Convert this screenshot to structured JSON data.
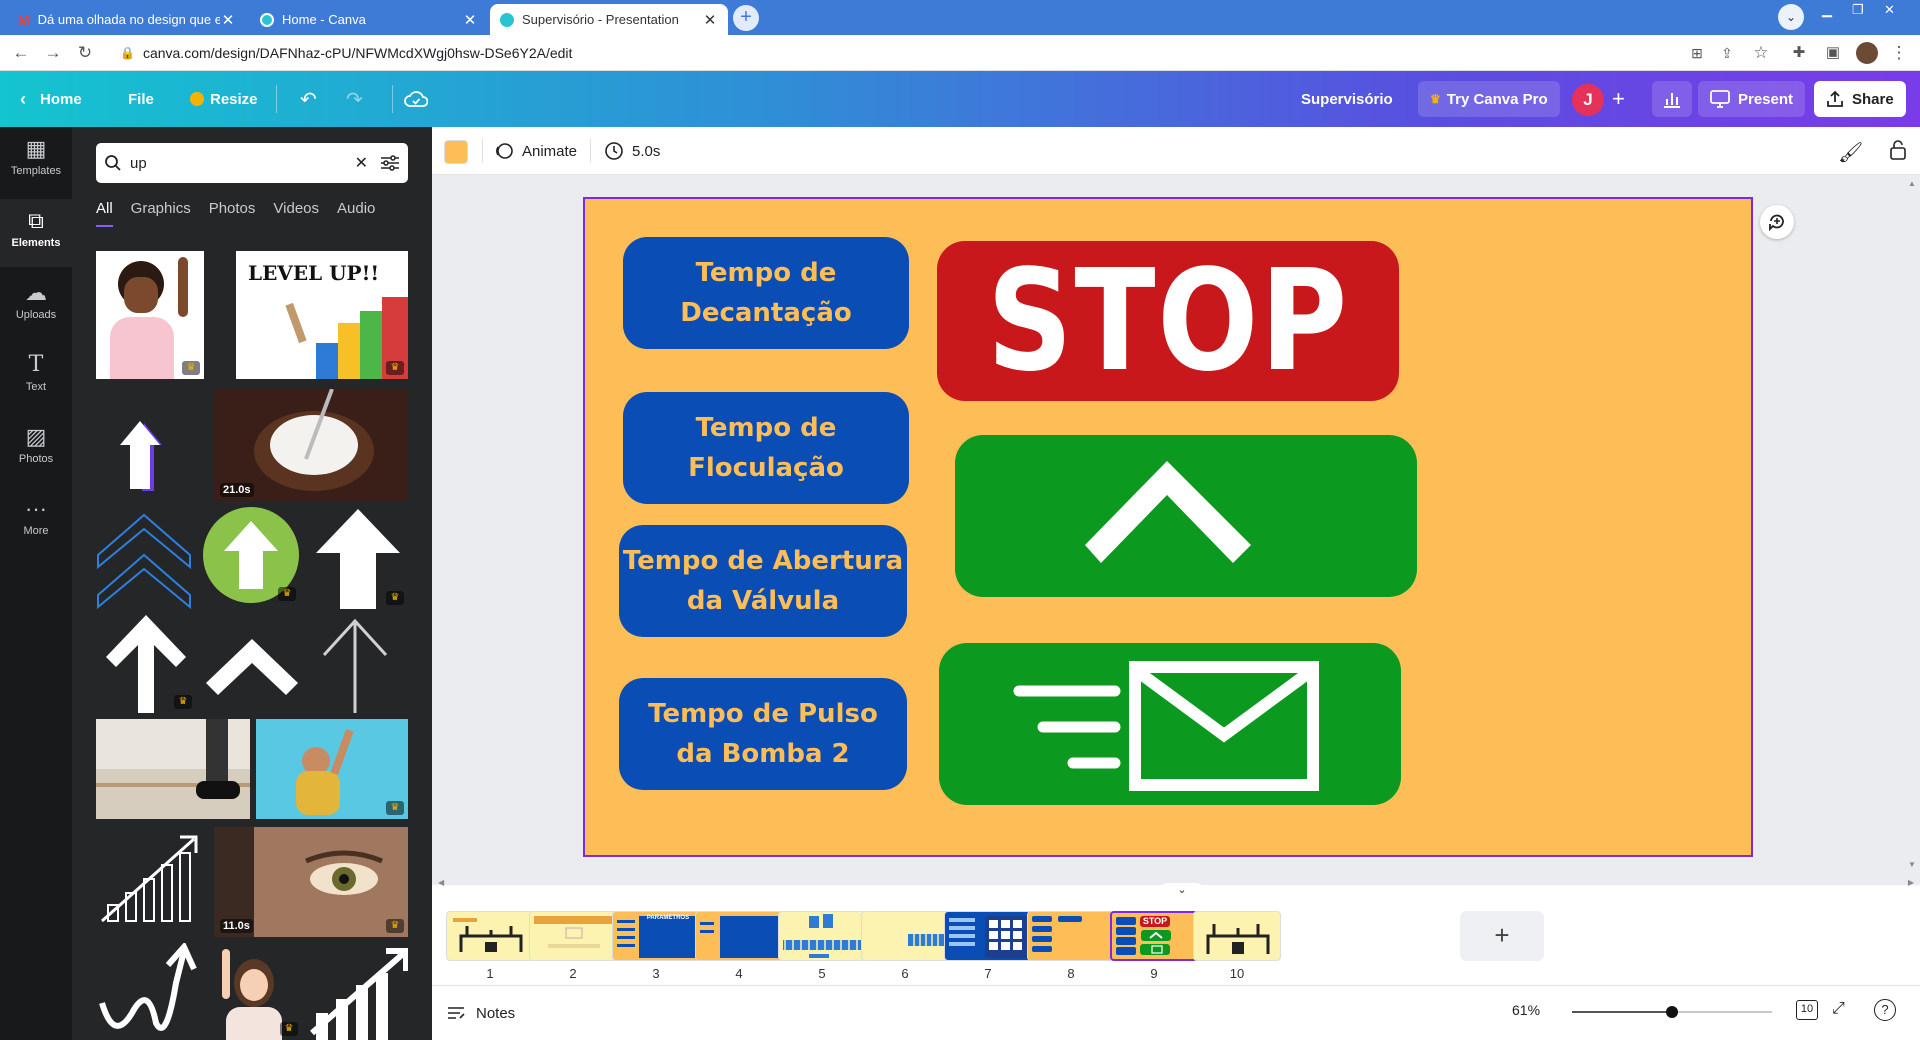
{
  "browser": {
    "tabs": [
      {
        "title": "Dá uma olhada no design que eu",
        "icon": "gmail-icon"
      },
      {
        "title": "Home - Canva",
        "icon": "canva-icon"
      },
      {
        "title": "Supervisório - Presentation",
        "icon": "canva-icon"
      }
    ],
    "url": "canva.com/design/DAFNhaz-cPU/NFWMcdXWgj0hsw-DSe6Y2A/edit"
  },
  "header": {
    "home": "Home",
    "file": "File",
    "resize": "Resize",
    "title": "Supervisório",
    "try_pro": "Try Canva Pro",
    "avatar_letter": "J",
    "present": "Present",
    "share": "Share"
  },
  "rail": {
    "items": [
      "Templates",
      "Elements",
      "Uploads",
      "Text",
      "Photos",
      "More"
    ]
  },
  "panel": {
    "search_value": "up",
    "tabs": [
      "All",
      "Graphics",
      "Photos",
      "Videos",
      "Audio"
    ],
    "thumb_texts": {
      "level_up": "LEVEL UP!!",
      "coconut_duration": "21.0s",
      "eye_duration": "11.0s"
    }
  },
  "editor": {
    "animate": "Animate",
    "duration": "5.0s",
    "accent_color": "#fdbd57"
  },
  "slide": {
    "pills": [
      {
        "line1": "Tempo de",
        "line2": "Decantação"
      },
      {
        "line1": "Tempo de",
        "line2": "Floculação"
      },
      {
        "line1": "Tempo de Abertura",
        "line2": "da Válvula"
      },
      {
        "line1": "Tempo de Pulso",
        "line2": "da Bomba 2"
      }
    ],
    "stop_text": "STOP",
    "colors": {
      "background": "#fdbd57",
      "pill": "#0a4db4",
      "stop": "#c8181c",
      "green": "#0c9920"
    }
  },
  "pages": {
    "numbers": [
      "1",
      "2",
      "3",
      "4",
      "5",
      "6",
      "7",
      "8",
      "9",
      "10"
    ],
    "active": "9",
    "thumb3_label": "PARAMETROS",
    "thumb9_label": "STOP"
  },
  "footer": {
    "notes": "Notes",
    "zoom": "61%",
    "zoom_level": 0.5,
    "page_count": "10"
  }
}
